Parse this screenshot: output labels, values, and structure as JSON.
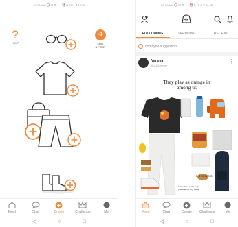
{
  "left_screen": {
    "status": {
      "left": "LG Mobile 💬 ✉ ⚙",
      "right": "⏰ ⏲ 76% ▮ 10:55"
    },
    "help_label": "HELP",
    "help_glyph": "?",
    "edit_post_label_1": "EDIT",
    "edit_post_label_2": "& POST",
    "items": [
      "glasses-icon",
      "tshirt-icon",
      "handbag-icon",
      "pants-icon",
      "boots-icon"
    ],
    "accent": "#f08a3a",
    "nav": [
      {
        "label": "Feed",
        "icon": "feed-icon"
      },
      {
        "label": "Chat",
        "icon": "chat-icon"
      },
      {
        "label": "Create",
        "icon": "create-icon"
      },
      {
        "label": "Challenge",
        "icon": "challenge-icon"
      },
      {
        "label": "Me",
        "icon": "avatar"
      }
    ],
    "active_nav": "Create",
    "sysnav": [
      "◁",
      "○",
      "□"
    ]
  },
  "right_screen": {
    "status": {
      "left": "LG Mobile 💬 ✉ ⚙",
      "right": "⏰ ⏲ 76% ▮ 10:55"
    },
    "tabs": [
      "FOLLOWING",
      "TRENDING",
      "RECENT"
    ],
    "active_tab": "FOLLOWING",
    "suggestion": "combyne suggestion",
    "user": {
      "name": "Vanesa",
      "time": "6 y a 1 heure"
    },
    "more_glyph": "⋮",
    "caption_line1": "They play as orange in",
    "caption_line2": "among us",
    "collage": {
      "brand_text": "FRIENDS",
      "note_line1": "some day , some way",
      "note_line2": "you'll know my name"
    },
    "nav": [
      {
        "label": "Feed",
        "icon": "feed-icon"
      },
      {
        "label": "Chat",
        "icon": "chat-icon"
      },
      {
        "label": "Create",
        "icon": "create-icon"
      },
      {
        "label": "Challenge",
        "icon": "challenge-icon"
      },
      {
        "label": "Me",
        "icon": "avatar"
      }
    ],
    "active_nav": "Feed",
    "sysnav": [
      "◁",
      "○",
      "□"
    ]
  }
}
